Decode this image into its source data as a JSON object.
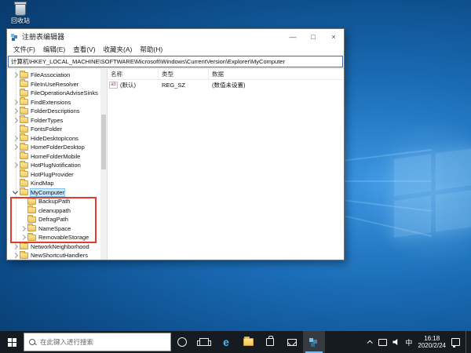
{
  "desktop": {
    "recycle_bin_label": "回收站"
  },
  "window": {
    "title": "注册表编辑器",
    "controls": {
      "minimize": "—",
      "maximize": "□",
      "close": "×"
    },
    "menu": [
      "文件(F)",
      "编辑(E)",
      "查看(V)",
      "收藏夹(A)",
      "帮助(H)"
    ],
    "address": "计算机\\HKEY_LOCAL_MACHINE\\SOFTWARE\\Microsoft\\Windows\\CurrentVersion\\Explorer\\MyComputer",
    "tree": {
      "items": [
        {
          "label": "FileAssociation",
          "state": "collapsed",
          "level": 0
        },
        {
          "label": "FileInUseResolver",
          "state": "none",
          "level": 0
        },
        {
          "label": "FileOperationAdviseSinks",
          "state": "none",
          "level": 0
        },
        {
          "label": "FindExtensions",
          "state": "collapsed",
          "level": 0
        },
        {
          "label": "FolderDescriptions",
          "state": "collapsed",
          "level": 0
        },
        {
          "label": "FolderTypes",
          "state": "collapsed",
          "level": 0
        },
        {
          "label": "FontsFolder",
          "state": "none",
          "level": 0
        },
        {
          "label": "HideDesktopIcons",
          "state": "collapsed",
          "level": 0
        },
        {
          "label": "HomeFolderDesktop",
          "state": "collapsed",
          "level": 0
        },
        {
          "label": "HomeFolderMobile",
          "state": "none",
          "level": 0
        },
        {
          "label": "HotPlugNotification",
          "state": "collapsed",
          "level": 0
        },
        {
          "label": "HotPlugProvider",
          "state": "none",
          "level": 0
        },
        {
          "label": "KindMap",
          "state": "none",
          "level": 0
        },
        {
          "label": "MyComputer",
          "state": "expanded",
          "level": 0,
          "selected": true
        },
        {
          "label": "BackupPath",
          "state": "none",
          "level": 1
        },
        {
          "label": "cleanuppath",
          "state": "none",
          "level": 1
        },
        {
          "label": "DefragPath",
          "state": "none",
          "level": 1
        },
        {
          "label": "NameSpace",
          "state": "collapsed",
          "level": 1
        },
        {
          "label": "RemovableStorage",
          "state": "collapsed",
          "level": 1
        },
        {
          "label": "NetworkNeighborhood",
          "state": "collapsed",
          "level": 0
        },
        {
          "label": "NewShortcutHandlers",
          "state": "collapsed",
          "level": 0
        }
      ]
    },
    "list": {
      "columns": [
        "名称",
        "类型",
        "数据"
      ],
      "rows": [
        {
          "icon": "ab",
          "name": "(默认)",
          "type": "REG_SZ",
          "data": "(数值未设置)"
        }
      ]
    }
  },
  "taskbar": {
    "search_placeholder": "在此键入进行搜索",
    "tray": {
      "ime": "中",
      "time": "16:18",
      "date": "2020/2/24"
    }
  }
}
